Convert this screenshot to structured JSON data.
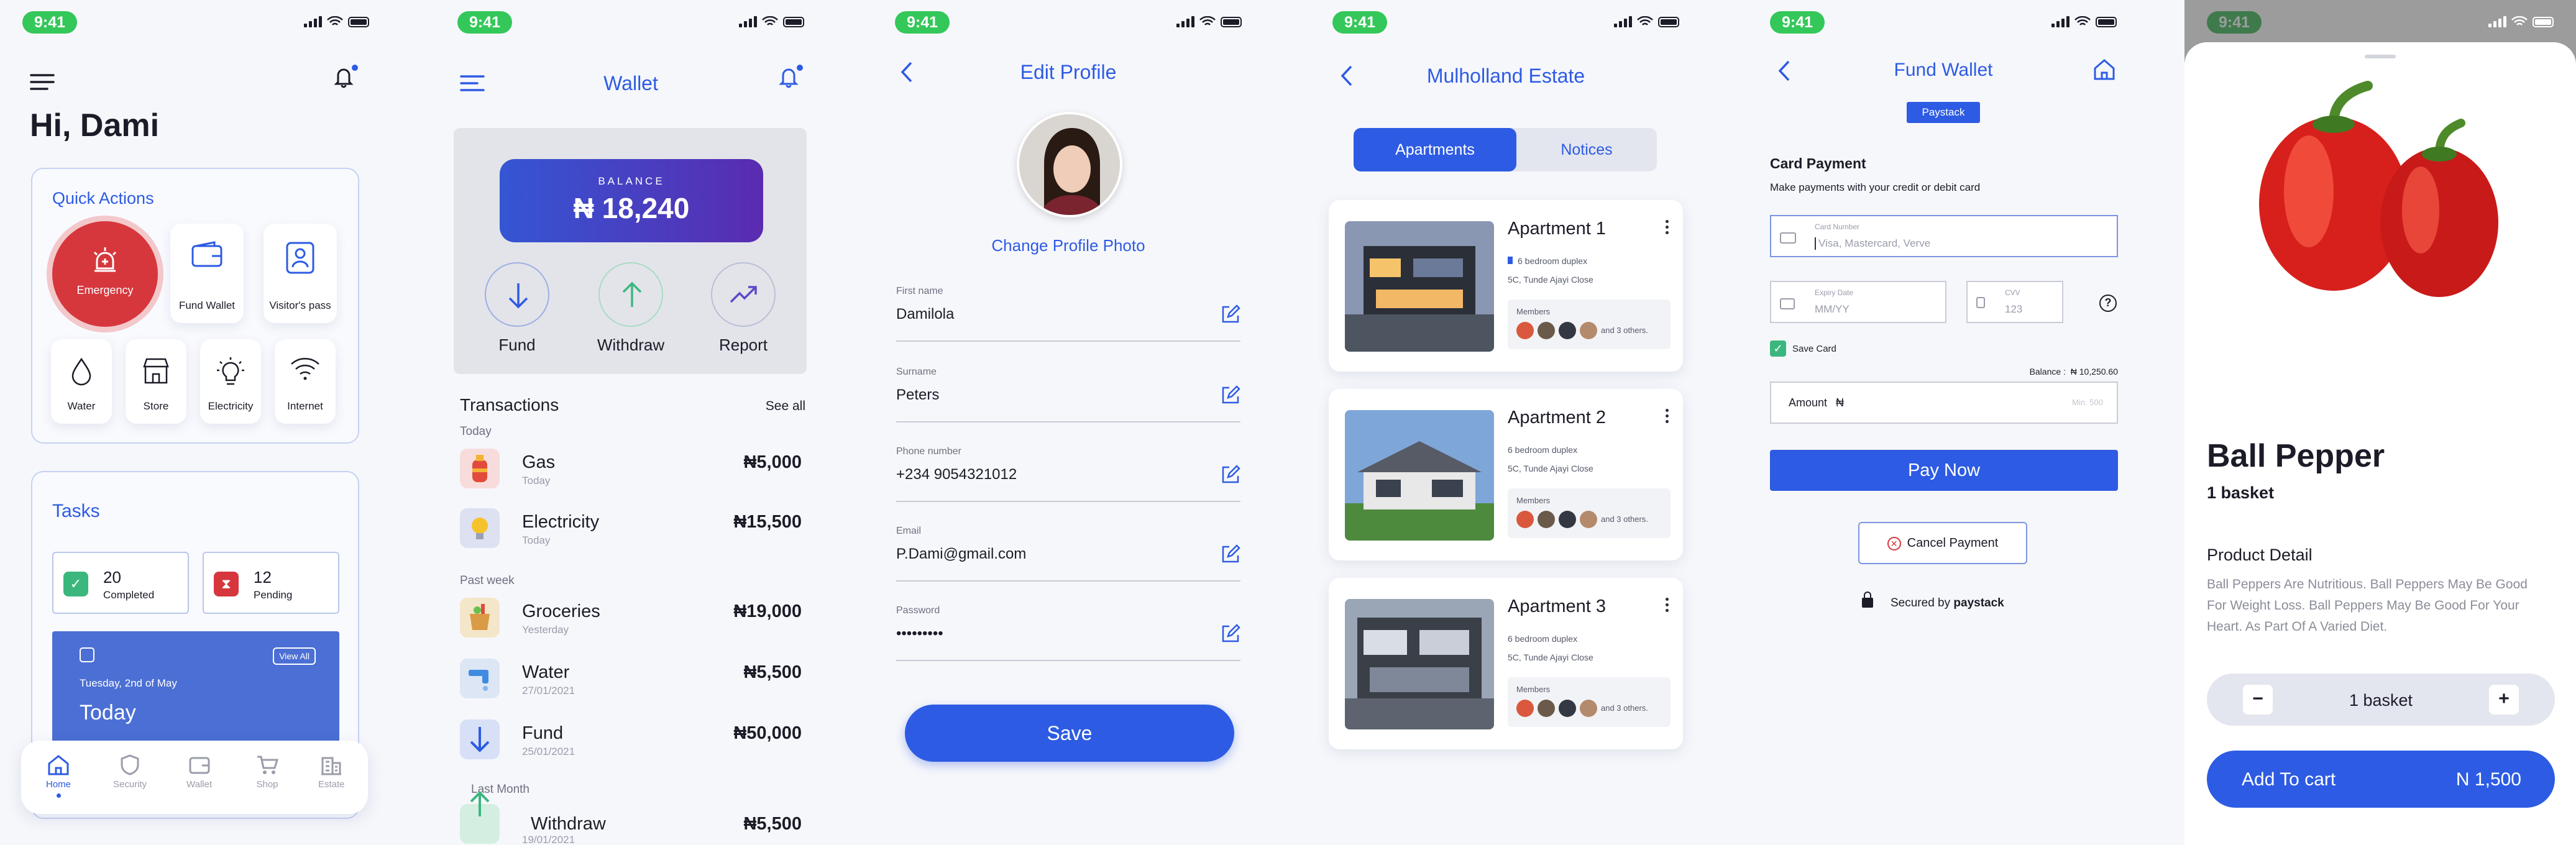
{
  "status_time": "9:41",
  "home": {
    "greeting": "Hi, Dami",
    "quick_actions_title": "Quick Actions",
    "actions": [
      "Emergency",
      "Fund Wallet",
      "Visitor's pass",
      "Water",
      "Store",
      "Electricity",
      "Internet"
    ],
    "tasks_title": "Tasks",
    "completed_count": "20",
    "completed_label": "Completed",
    "pending_count": "12",
    "pending_label": "Pending",
    "task_date": "Tuesday, 2nd of May",
    "view_all": "View All",
    "today": "Today",
    "nav": [
      "Home",
      "Security",
      "Wallet",
      "Shop",
      "Estate"
    ]
  },
  "wallet": {
    "title": "Wallet",
    "balance_label": "BALANCE",
    "balance": "₦ 18,240",
    "actions": [
      "Fund",
      "Withdraw",
      "Report"
    ],
    "transactions_title": "Transactions",
    "see_all": "See all",
    "group_today": "Today",
    "group_past_week": "Past week",
    "group_last_month": "Last Month",
    "transactions": [
      {
        "name": "Gas",
        "date": "Today",
        "amount": "₦5,000"
      },
      {
        "name": "Electricity",
        "date": "Today",
        "amount": "₦15,500"
      },
      {
        "name": "Groceries",
        "date": "Yesterday",
        "amount": "₦19,000"
      },
      {
        "name": "Water",
        "date": "27/01/2021",
        "amount": "₦5,500"
      },
      {
        "name": "Fund",
        "date": "25/01/2021",
        "amount": "₦50,000"
      },
      {
        "name": "Withdraw",
        "date": "19/01/2021",
        "amount": "₦5,500"
      }
    ]
  },
  "profile": {
    "title": "Edit Profile",
    "change_photo": "Change Profile Photo",
    "fields": [
      {
        "label": "First name",
        "value": "Damilola"
      },
      {
        "label": "Surname",
        "value": "Peters"
      },
      {
        "label": "Phone number",
        "value": "+234 9054321012"
      },
      {
        "label": "Email",
        "value": "P.Dami@gmail.com"
      },
      {
        "label": "Password",
        "value": "•••••••••"
      }
    ],
    "save": "Save"
  },
  "estate": {
    "title": "Mulholland Estate",
    "tab_active": "Apartments",
    "tab_inactive": "Notices",
    "apartments": [
      {
        "name": "Apartment 1",
        "type": "6 bedroom duplex",
        "address": "5C, Tunde Ajayi Close",
        "members_label": "Members",
        "others": "and 3 others."
      },
      {
        "name": "Apartment 2",
        "type": "6 bedroom duplex",
        "address": "5C, Tunde Ajayi Close",
        "members_label": "Members",
        "others": "and 3 others."
      },
      {
        "name": "Apartment 3",
        "type": "6 bedroom duplex",
        "address": "5C, Tunde Ajayi Close",
        "members_label": "Members",
        "others": "and 3 others."
      }
    ]
  },
  "fund": {
    "title": "Fund Wallet",
    "badge": "Paystack",
    "card_payment": "Card Payment",
    "card_sub": "Make payments with your credit or debit card",
    "card_number_label": "Card Number",
    "card_number_placeholder": "Visa, Mastercard, Verve",
    "expiry_label": "Expiry Date",
    "expiry_placeholder": "MM/YY",
    "cvv_label": "CVV",
    "cvv_placeholder": "123",
    "save_card": "Save Card",
    "balance_text": "Balance :  ₦ 10,250.60",
    "amount_label": "Amount",
    "amount_currency": "₦",
    "amount_min": "Min. 500",
    "pay_now": "Pay Now",
    "cancel": "Cancel Payment",
    "secured_by": "Secured by",
    "paystack": "paystack"
  },
  "product": {
    "name": "Ball Pepper",
    "unit": "1 basket",
    "detail_title": "Product Detail",
    "description": "Ball Peppers Are Nutritious. Ball Peppers May Be Good For Weight Loss. Ball Peppers May Be Good For Your Heart. As Part Of A Varied Diet.",
    "qty": "1 basket",
    "minus": "−",
    "plus": "+",
    "add_to_cart": "Add To cart",
    "price": "N 1,500"
  },
  "colors": {
    "accent": "#2d5be3",
    "emergency": "#d6373d",
    "success": "#3bb77e"
  }
}
